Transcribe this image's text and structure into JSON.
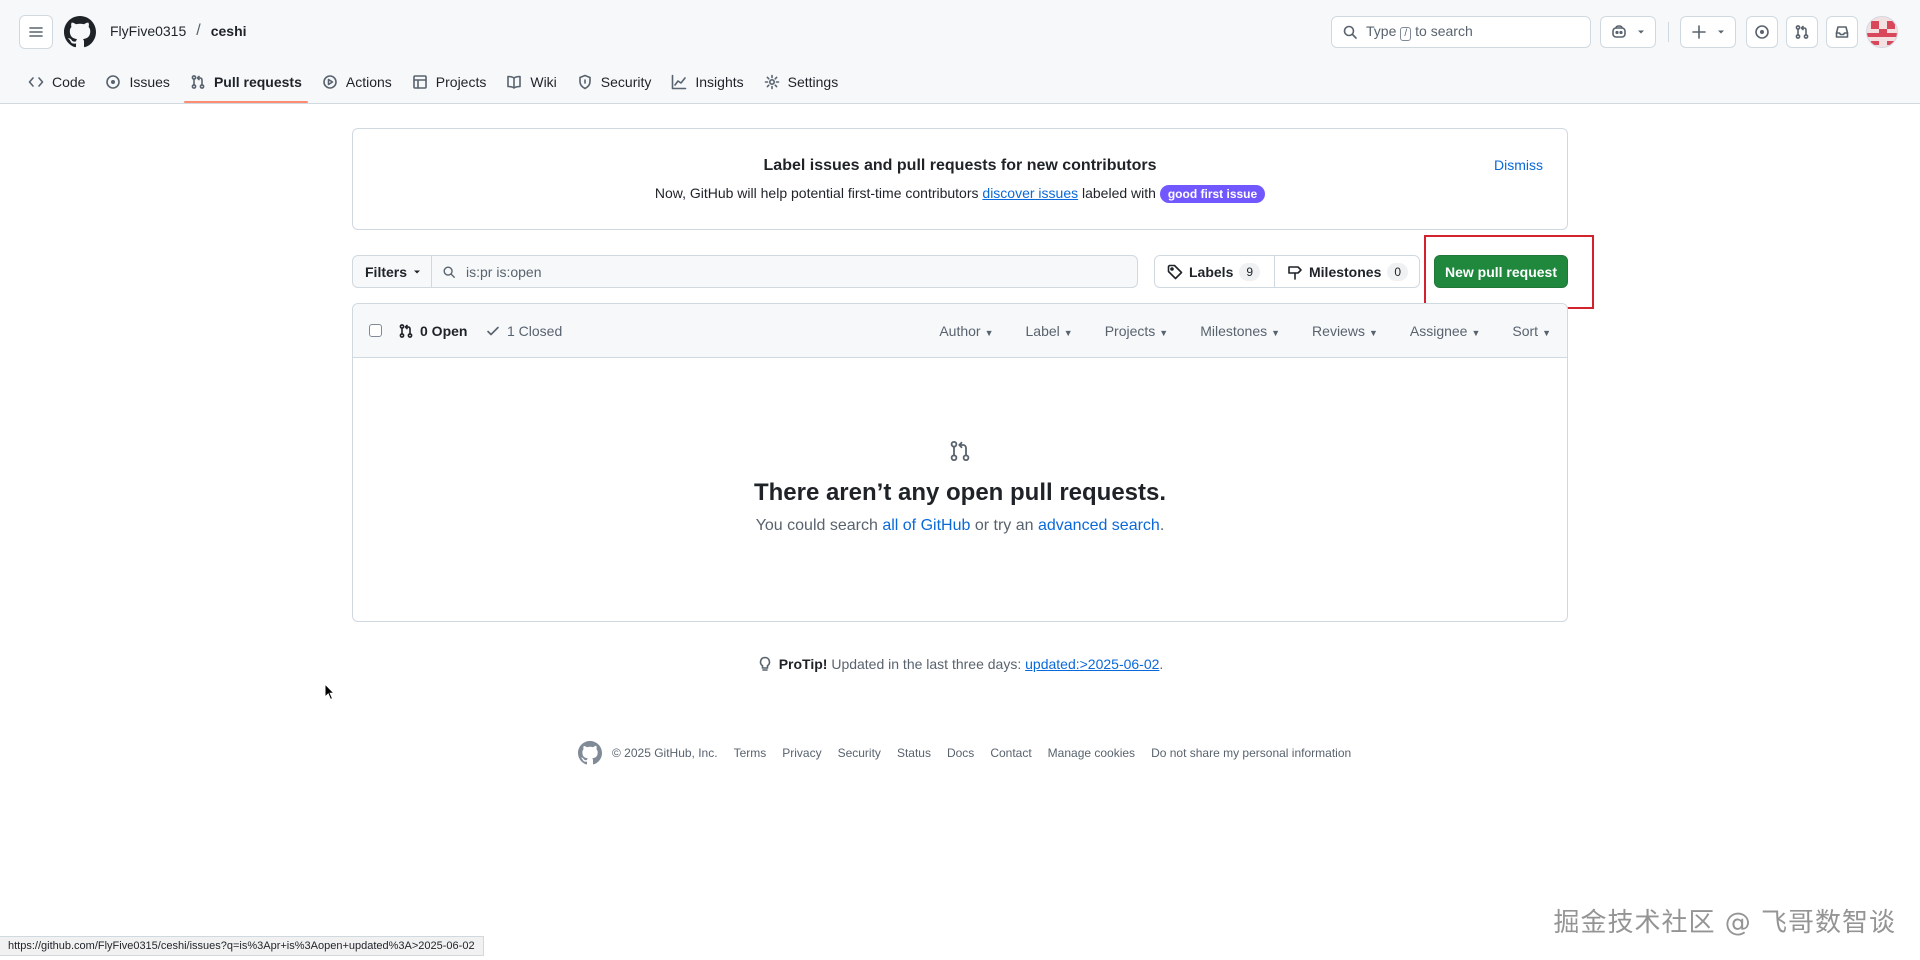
{
  "header": {
    "owner": "FlyFive0315",
    "separator": "/",
    "repo": "ceshi",
    "search": {
      "prefix": "Type",
      "key": "/",
      "suffix": "to search"
    },
    "plus_label": "+"
  },
  "nav": {
    "tabs": [
      {
        "label": "Code",
        "icon": "code-icon"
      },
      {
        "label": "Issues",
        "icon": "issue-opened-icon"
      },
      {
        "label": "Pull requests",
        "icon": "git-pull-request-icon",
        "selected": true
      },
      {
        "label": "Actions",
        "icon": "play-icon"
      },
      {
        "label": "Projects",
        "icon": "table-icon"
      },
      {
        "label": "Wiki",
        "icon": "book-icon"
      },
      {
        "label": "Security",
        "icon": "shield-icon"
      },
      {
        "label": "Insights",
        "icon": "graph-icon"
      },
      {
        "label": "Settings",
        "icon": "gear-icon"
      }
    ]
  },
  "banner": {
    "title": "Label issues and pull requests for new contributors",
    "text_before": "Now, GitHub will help potential first-time contributors",
    "link": "discover issues",
    "text_after": "labeled with",
    "badge": "good first issue",
    "dismiss": "Dismiss"
  },
  "toolbar": {
    "filters": "Filters",
    "query": "is:pr is:open",
    "labels": "Labels",
    "labels_count": "9",
    "milestones": "Milestones",
    "milestones_count": "0",
    "new_pr": "New pull request"
  },
  "list": {
    "open": "0 Open",
    "closed": "1 Closed",
    "menus": [
      "Author",
      "Label",
      "Projects",
      "Milestones",
      "Reviews",
      "Assignee",
      "Sort"
    ]
  },
  "blankslate": {
    "title": "There aren’t any open pull requests.",
    "sub_before": "You could search",
    "link1": "all of GitHub",
    "sub_middle": "or try an",
    "link2": "advanced search",
    "sub_end": "."
  },
  "protip": {
    "label": "ProTip!",
    "text": "Updated in the last three days:",
    "link": "updated:>2025-06-02",
    "end": "."
  },
  "footer": {
    "copyright": "© 2025 GitHub, Inc.",
    "links": [
      "Terms",
      "Privacy",
      "Security",
      "Status",
      "Docs",
      "Contact",
      "Manage cookies",
      "Do not share my personal information"
    ]
  },
  "status_url": "https://github.com/FlyFive0315/ceshi/issues?q=is%3Apr+is%3Aopen+updated%3A>2025-06-02",
  "watermark": "掘金技术社区 @ 飞哥数智谈",
  "colors": {
    "accent_green": "#1f883d",
    "link": "#0969da",
    "selected_underline": "#fd8c73",
    "badge_purple": "#7057ff",
    "highlight_red": "#d2222d"
  }
}
